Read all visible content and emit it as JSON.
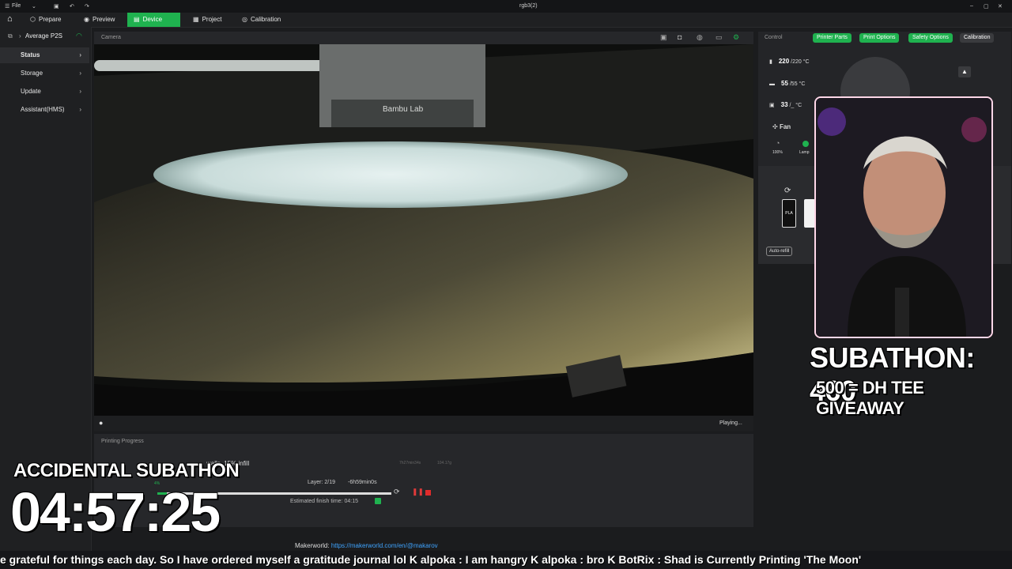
{
  "titlebar": {
    "file_label": "File",
    "window_title": "rgb3(2)"
  },
  "tabs": [
    {
      "label": "Prepare",
      "icon": "cube-icon"
    },
    {
      "label": "Preview",
      "icon": "eye-icon"
    },
    {
      "label": "Device",
      "icon": "device-icon"
    },
    {
      "label": "Project",
      "icon": "project-icon"
    },
    {
      "label": "Calibration",
      "icon": "target-icon"
    }
  ],
  "sidebar": {
    "printer_name": "Average P2S",
    "items": [
      {
        "label": "Status"
      },
      {
        "label": "Storage"
      },
      {
        "label": "Update"
      },
      {
        "label": "Assistant(HMS)"
      }
    ]
  },
  "camera": {
    "title": "Camera",
    "status": "Playing...",
    "brand_text": "Bambu Lab"
  },
  "progress": {
    "title": "Printing Progress",
    "job_text": "walls, 15% infill",
    "time_small": "7h27min34s",
    "weight_small": "104.17g",
    "layer_text": "Layer: 2/19",
    "remaining": "-6h59min0s",
    "finish_label": "Estimated finish time: 04:15",
    "percent": 0.04,
    "percent_label": "4%"
  },
  "control": {
    "title": "Control",
    "buttons": [
      "Printer Parts",
      "Print Options",
      "Safety Options",
      "Calibration"
    ],
    "nozzle": {
      "current": "220",
      "target": "/220",
      "unit": "°C"
    },
    "bed": {
      "current": "55",
      "target": "/55",
      "unit": "°C"
    },
    "chamber": {
      "current": "33",
      "target": "/_",
      "unit": "°C"
    },
    "fan_label": "Fan",
    "fan_percent": "100%",
    "lamp_label": "Lamp",
    "filament_label": "PLA",
    "auto_refill": "Auto-refill"
  },
  "overlays": {
    "subathon_count": "SUBATHON: 460",
    "giveaway": "500 = DH TEE GIVEAWAY",
    "timer_title": "ACCIDENTAL SUBATHON",
    "timer": "04:57:25"
  },
  "makerworld": {
    "label": "Makerworld:",
    "link": "https://makerworld.com/en/@makarov"
  },
  "ticker": "e grateful for things each day. So I have ordered myself a gratitude journal lol  K  alpoka :  I am hangry   K  alpoka :  bro   K   BotRix :  Shad is Currently Printing 'The Moon'",
  "colors": {
    "accent": "#1fb24f",
    "link": "#3fa4ff",
    "stop": "#e02b2b",
    "pause": "#e03a3a"
  }
}
